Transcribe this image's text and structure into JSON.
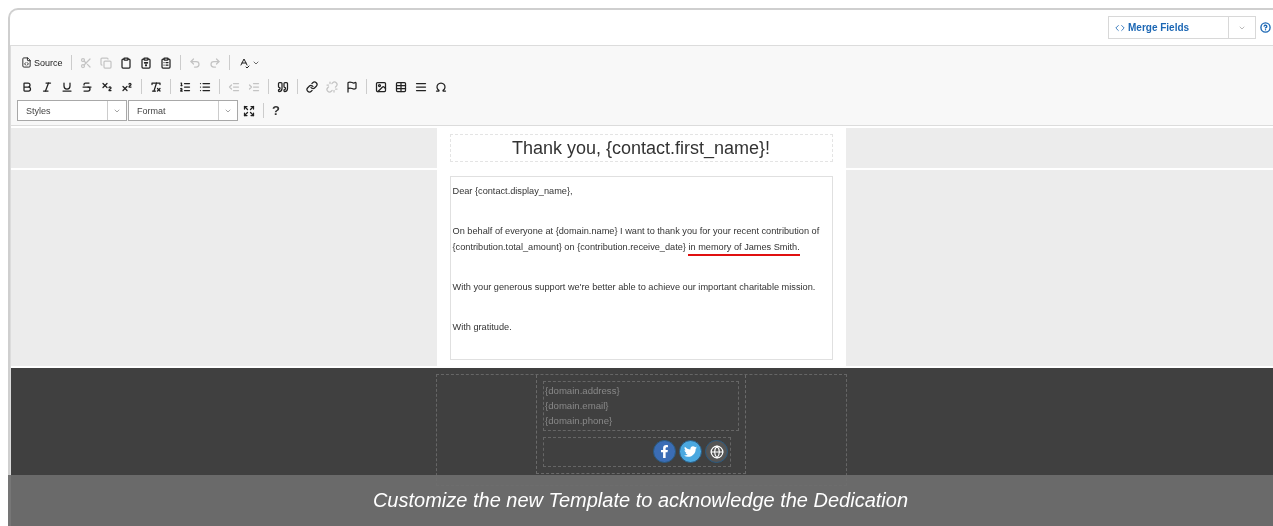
{
  "merge_fields": {
    "label": "Merge Fields"
  },
  "toolbar": {
    "rows": [
      {
        "groups": [
          [
            {
              "kind": "source",
              "label": "Source",
              "disabled": false
            }
          ],
          [
            {
              "kind": "icon",
              "disabled": true
            },
            {
              "kind": "icon",
              "disabled": true
            },
            {
              "kind": "icon",
              "disabled": false
            },
            {
              "kind": "icon",
              "disabled": false
            },
            {
              "kind": "icon",
              "disabled": false
            }
          ],
          [
            {
              "kind": "icon",
              "disabled": true
            },
            {
              "kind": "icon",
              "disabled": true
            }
          ],
          [
            {
              "kind": "menu",
              "disabled": false
            }
          ]
        ]
      },
      {
        "groups": [
          [
            {
              "kind": "icon",
              "disabled": false
            },
            {
              "kind": "icon",
              "disabled": false
            },
            {
              "kind": "icon",
              "disabled": false
            },
            {
              "kind": "icon",
              "disabled": false
            },
            {
              "kind": "icon",
              "disabled": false
            },
            {
              "kind": "icon",
              "disabled": false
            }
          ],
          [
            {
              "kind": "icon",
              "disabled": false
            }
          ],
          [
            {
              "kind": "icon",
              "disabled": false
            },
            {
              "kind": "icon",
              "disabled": false
            }
          ],
          [
            {
              "kind": "icon",
              "disabled": true
            },
            {
              "kind": "icon",
              "disabled": true
            }
          ],
          [
            {
              "kind": "icon",
              "disabled": false
            }
          ],
          [
            {
              "kind": "icon",
              "disabled": false
            },
            {
              "kind": "icon",
              "disabled": true
            },
            {
              "kind": "icon",
              "disabled": false
            }
          ],
          [
            {
              "kind": "icon",
              "disabled": false
            },
            {
              "kind": "icon",
              "disabled": false
            },
            {
              "kind": "icon",
              "disabled": false
            },
            {
              "kind": "icon",
              "disabled": false
            }
          ]
        ]
      },
      {
        "groups": [
          [
            {
              "kind": "dropdown",
              "label": "Styles"
            },
            {
              "kind": "dropdown",
              "label": "Format"
            },
            {
              "kind": "icon",
              "disabled": false
            }
          ],
          [
            {
              "kind": "text",
              "label": "?"
            }
          ]
        ]
      }
    ]
  },
  "email": {
    "title": "Thank you, {contact.first_name}!",
    "paragraphs": [
      {
        "text": "Dear {contact.display_name},"
      },
      {
        "text": "On behalf of everyone at {domain.name} I want to thank you for your recent contribution of {contribution.total_amount} on {contribution.receive_date} ",
        "highlight": "in memory of James Smith."
      },
      {
        "text": "With your generous support we're better able to achieve our important charitable mission."
      },
      {
        "text": "With gratitude."
      }
    ],
    "footer_lines": [
      "{domain.address}",
      "{domain.email}",
      "{domain.phone}"
    ]
  },
  "caption": "Customize the new Template to acknowledge the Dedication"
}
